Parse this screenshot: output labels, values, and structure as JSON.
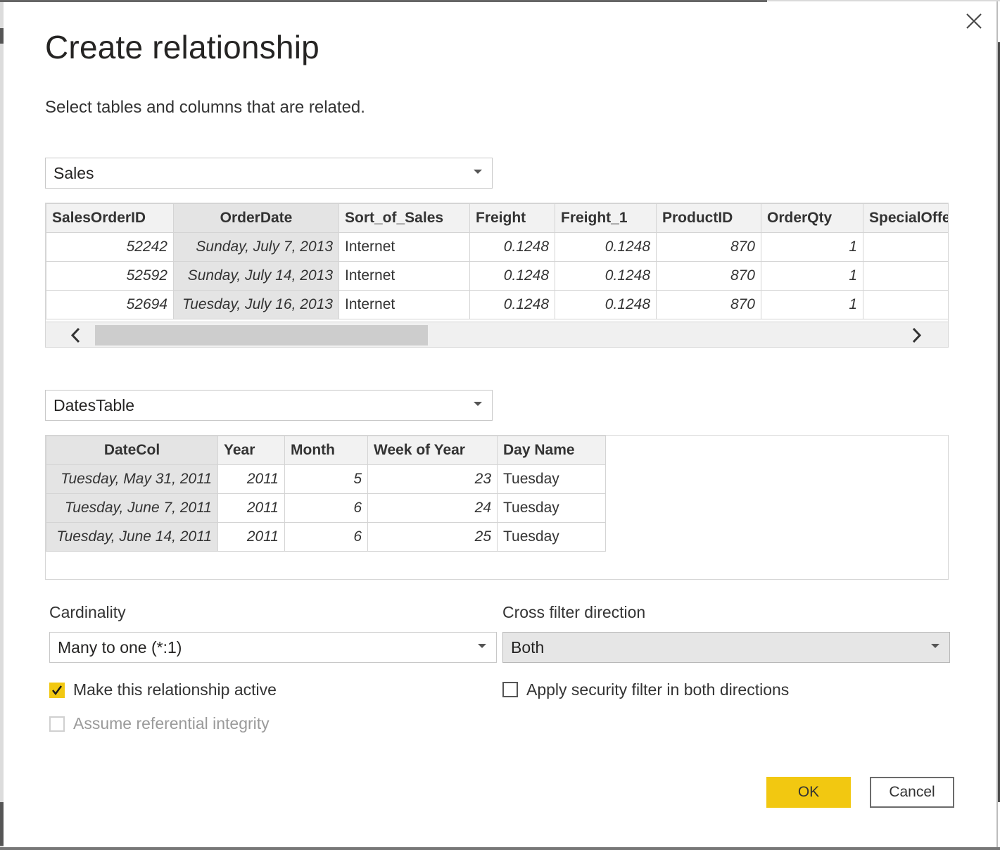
{
  "dialog": {
    "title": "Create relationship",
    "subtitle": "Select tables and columns that are related.",
    "close_icon": "close-icon"
  },
  "table1": {
    "selected": "Sales",
    "columns": [
      "SalesOrderID",
      "OrderDate",
      "Sort_of_Sales",
      "Freight",
      "Freight_1",
      "ProductID",
      "OrderQty",
      "SpecialOffe"
    ],
    "rows": [
      [
        "52242",
        "Sunday, July 7, 2013",
        "Internet",
        "0.1248",
        "0.1248",
        "870",
        "1",
        ""
      ],
      [
        "52592",
        "Sunday, July 14, 2013",
        "Internet",
        "0.1248",
        "0.1248",
        "870",
        "1",
        ""
      ],
      [
        "52694",
        "Tuesday, July 16, 2013",
        "Internet",
        "0.1248",
        "0.1248",
        "870",
        "1",
        ""
      ]
    ],
    "selected_column": "OrderDate"
  },
  "table2": {
    "selected": "DatesTable",
    "columns": [
      "DateCol",
      "Year",
      "Month",
      "Week of Year",
      "Day Name"
    ],
    "rows": [
      [
        "Tuesday, May 31, 2011",
        "2011",
        "5",
        "23",
        "Tuesday"
      ],
      [
        "Tuesday, June 7, 2011",
        "2011",
        "6",
        "24",
        "Tuesday"
      ],
      [
        "Tuesday, June 14, 2011",
        "2011",
        "6",
        "25",
        "Tuesday"
      ]
    ],
    "selected_column": "DateCol"
  },
  "cardinality": {
    "label": "Cardinality",
    "value": "Many to one (*:1)"
  },
  "cross_filter": {
    "label": "Cross filter direction",
    "value": "Both"
  },
  "options": {
    "active": {
      "label": "Make this relationship active",
      "checked": true
    },
    "referential": {
      "label": "Assume referential integrity",
      "checked": false,
      "disabled": true
    },
    "security": {
      "label": "Apply security filter in both directions",
      "checked": false
    }
  },
  "buttons": {
    "ok": "OK",
    "cancel": "Cancel"
  },
  "colors": {
    "accent": "#f2c811",
    "selected_column_bg": "#e4e4e4"
  }
}
